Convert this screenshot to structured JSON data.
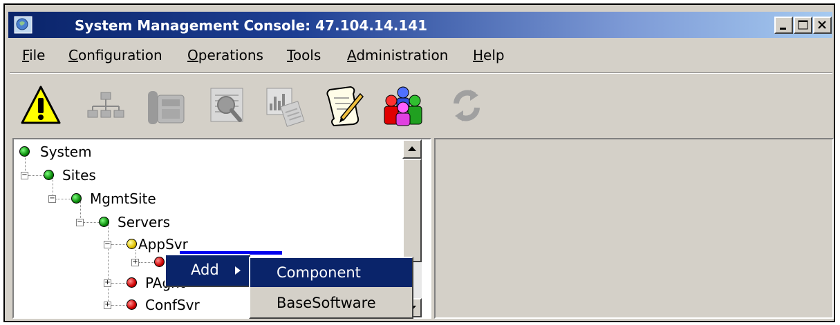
{
  "window": {
    "title": "System Management Console: 47.104.14.141",
    "icon": "console-icon",
    "controls": [
      "minimize-icon",
      "maximize-icon",
      "close-icon"
    ]
  },
  "menubar": {
    "items": [
      {
        "label": "File",
        "mnemonic": "F",
        "rest": "ile"
      },
      {
        "label": "Configuration",
        "mnemonic": "C",
        "rest": "onfiguration"
      },
      {
        "label": "Operations",
        "mnemonic": "O",
        "rest": "perations"
      },
      {
        "label": "Tools",
        "mnemonic": "T",
        "rest": "ools"
      },
      {
        "label": "Administration",
        "mnemonic": "A",
        "rest": "dministration"
      },
      {
        "label": "Help",
        "mnemonic": "H",
        "rest": "elp"
      }
    ]
  },
  "toolbar": {
    "icons": [
      "alarm-warning-icon",
      "topology-icon",
      "telephone-icon",
      "log-viewer-icon",
      "reports-icon",
      "scroll-edit-icon",
      "users-group-icon",
      "refresh-icon"
    ]
  },
  "tree": {
    "nodes": [
      {
        "label": "System",
        "status": "green"
      },
      {
        "label": "Sites",
        "status": "green"
      },
      {
        "label": "MgmtSite",
        "status": "green"
      },
      {
        "label": "Servers",
        "status": "green"
      },
      {
        "label": "AppSvr",
        "status": "yellow"
      },
      {
        "label": "",
        "status": "red"
      },
      {
        "label": "PAgnt",
        "status": "red"
      },
      {
        "label": "ConfSvr",
        "status": "red"
      }
    ]
  },
  "context_menu": {
    "items": [
      {
        "label": "Add"
      }
    ],
    "submenu": [
      {
        "label": "Component",
        "selected": true
      },
      {
        "label": "BaseSoftware",
        "selected": false
      }
    ]
  },
  "colors": {
    "title_gradient_start": "#0a246a",
    "title_gradient_end": "#a6caf0",
    "selection": "#0a246a",
    "chrome": "#d4d0c8"
  }
}
